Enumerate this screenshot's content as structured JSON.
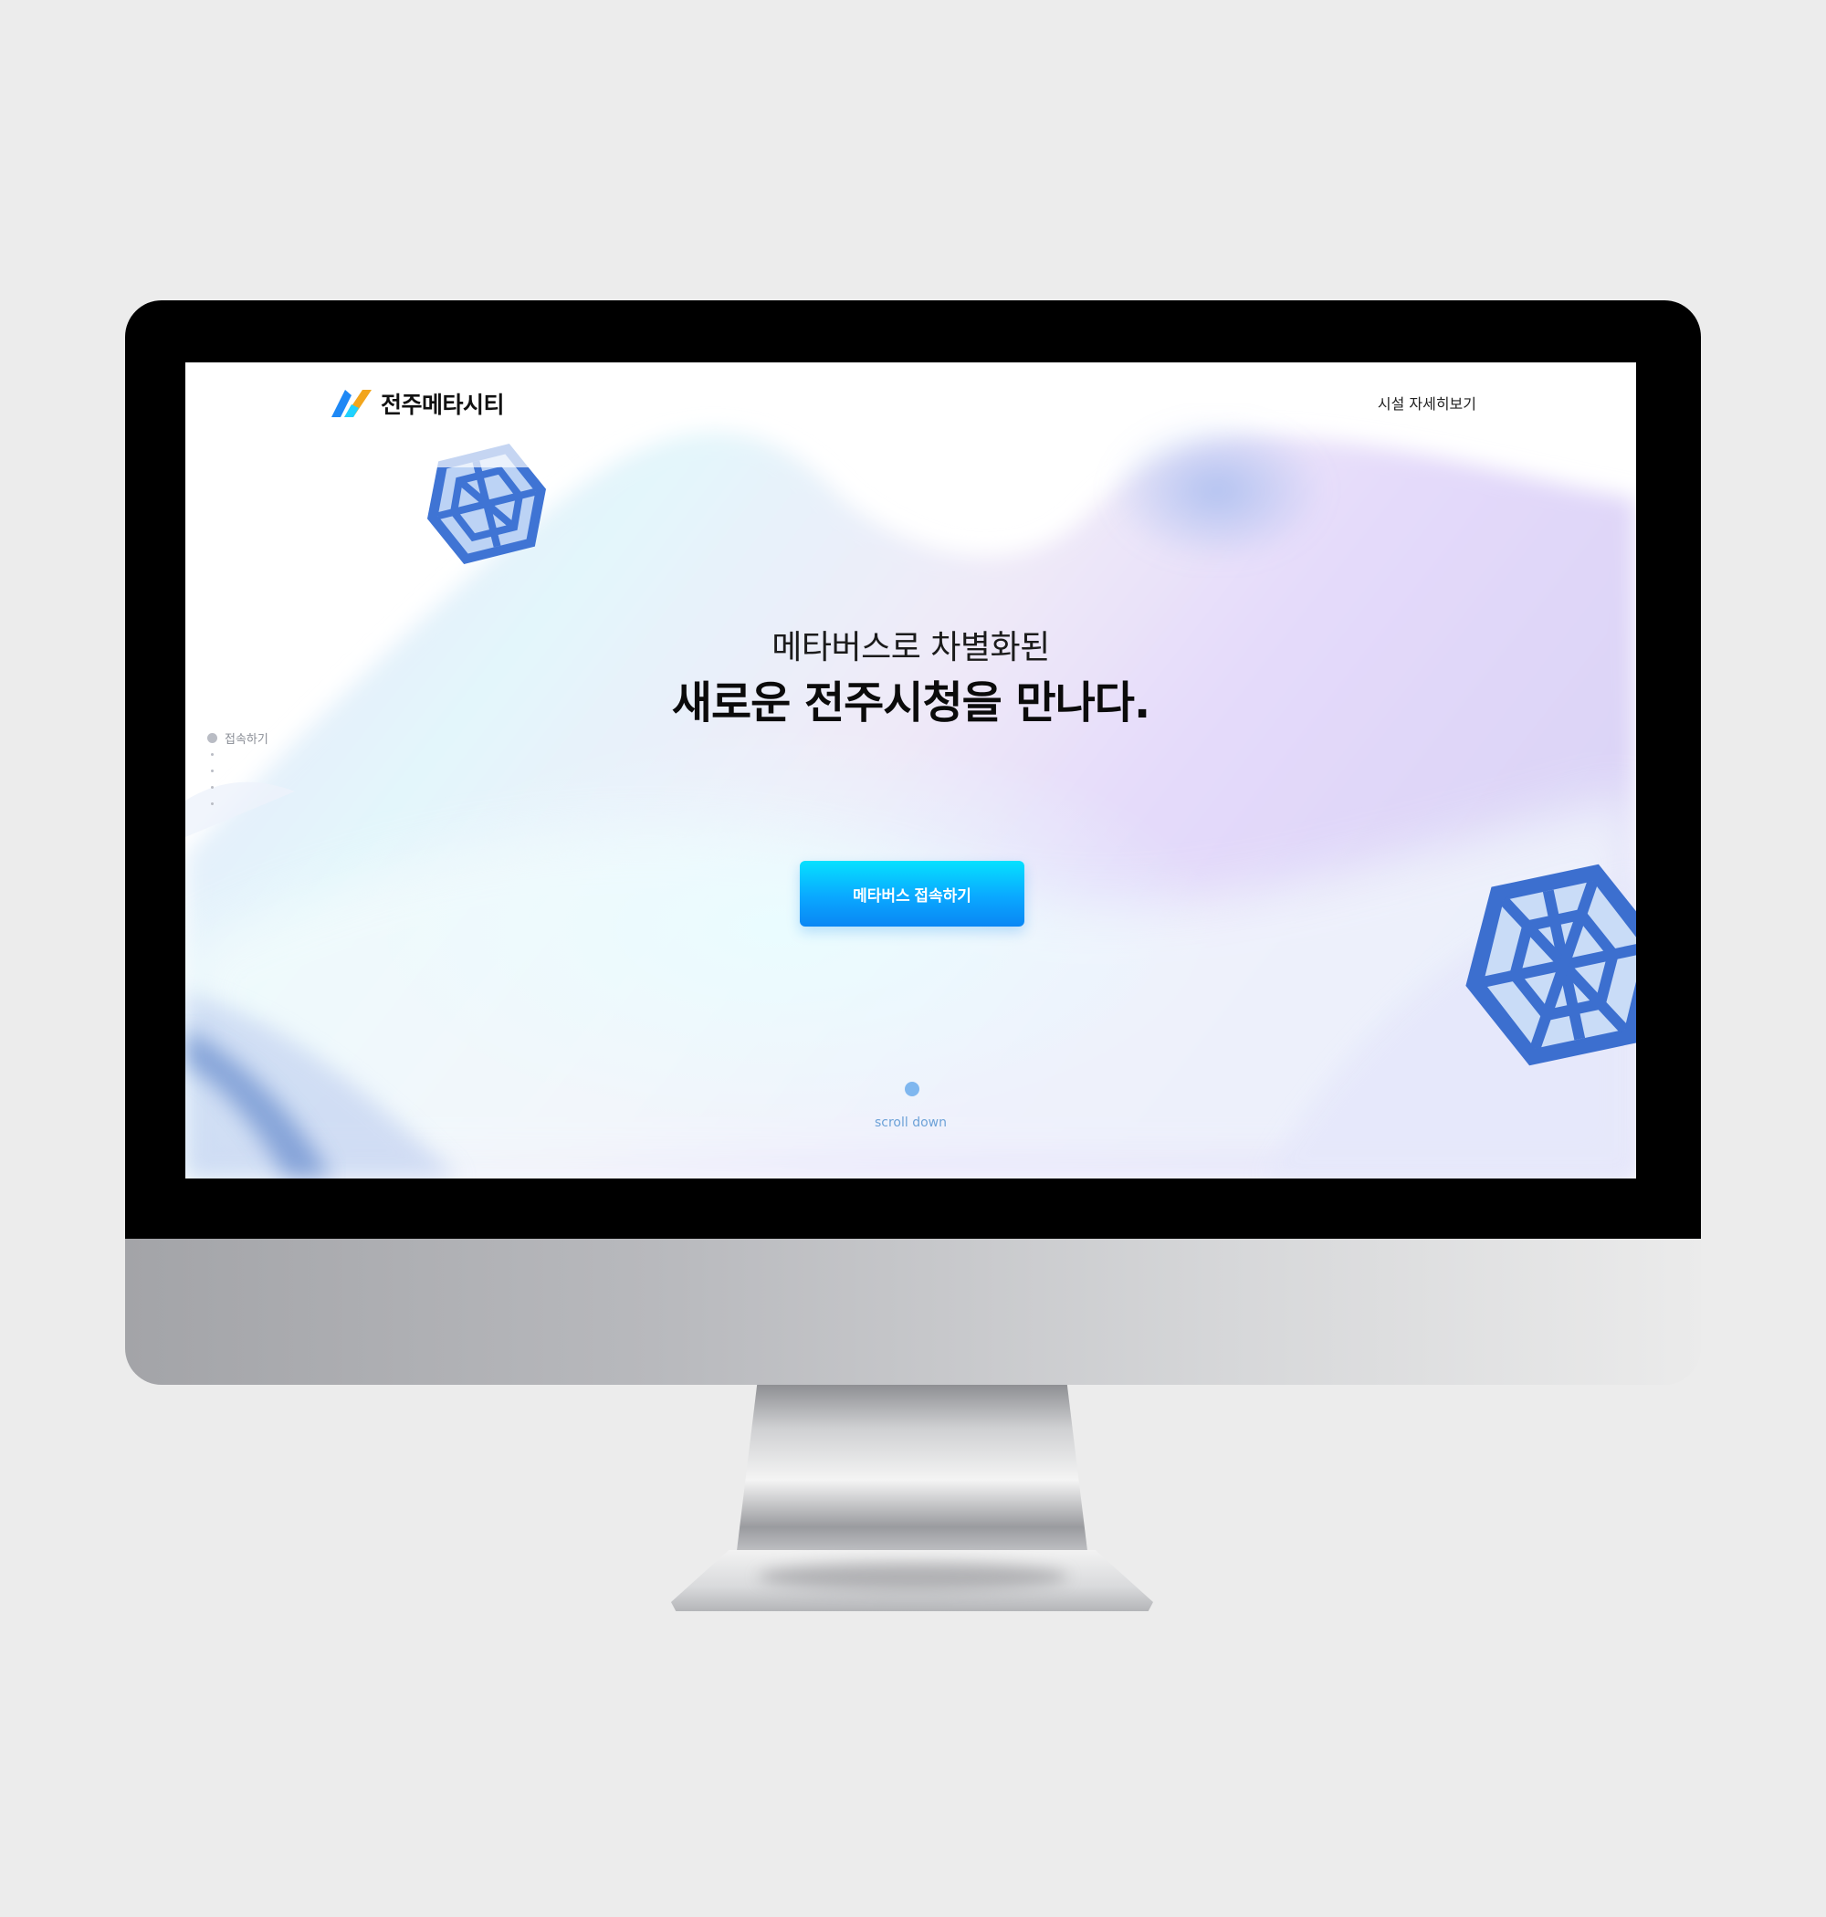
{
  "header": {
    "logo_text": "전주메타시티",
    "nav_link": "시설 자세히보기"
  },
  "hero": {
    "subtitle": "메타버스로 차별화된",
    "title": "새로운 전주시청을 만나다.",
    "cta_label": "메타버스 접속하기"
  },
  "side_nav": {
    "items": [
      {
        "label": "접속하기",
        "active": true
      },
      {
        "label": "",
        "active": false
      },
      {
        "label": "",
        "active": false
      },
      {
        "label": "",
        "active": false
      },
      {
        "label": "",
        "active": false
      }
    ]
  },
  "scroll": {
    "label": "scroll down"
  },
  "colors": {
    "accent": "#0aa8ff",
    "accent_light": "#06e1ff",
    "scroll": "#7fb7ef",
    "background": "#ececec",
    "bezel": "#000000"
  },
  "icons": {
    "logo": "logo-mark-icon",
    "decoration_top": "hexagon-lattice-icon",
    "decoration_right": "hexagon-lattice-icon"
  }
}
